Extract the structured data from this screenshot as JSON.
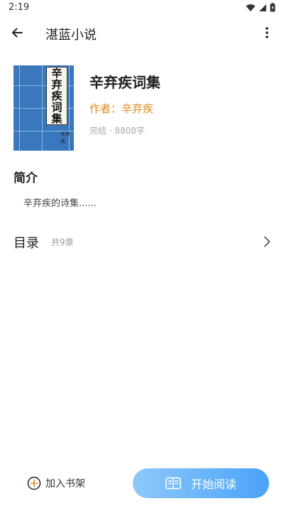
{
  "status_bar": {
    "time": "2:19"
  },
  "app_bar": {
    "title": "湛蓝小说"
  },
  "book": {
    "cover_title_chars": [
      "辛",
      "弃",
      "疾",
      "词",
      "集"
    ],
    "cover_stamp": "辛弃疾",
    "title": "辛弃疾词集",
    "author": "作者：辛弃疾",
    "meta": "完结 · 8808字"
  },
  "intro": {
    "heading": "简介",
    "text": "辛弃疾的诗集......"
  },
  "toc": {
    "label": "目录",
    "count": "共9章"
  },
  "actions": {
    "add_shelf_label": "加入书架",
    "start_read_label": "开始阅读"
  },
  "colors": {
    "accent_orange": "#e08a1e",
    "read_button_start": "#8ec8fb",
    "read_button_end": "#4aa3f7",
    "cover_blue": "#3a78be"
  }
}
